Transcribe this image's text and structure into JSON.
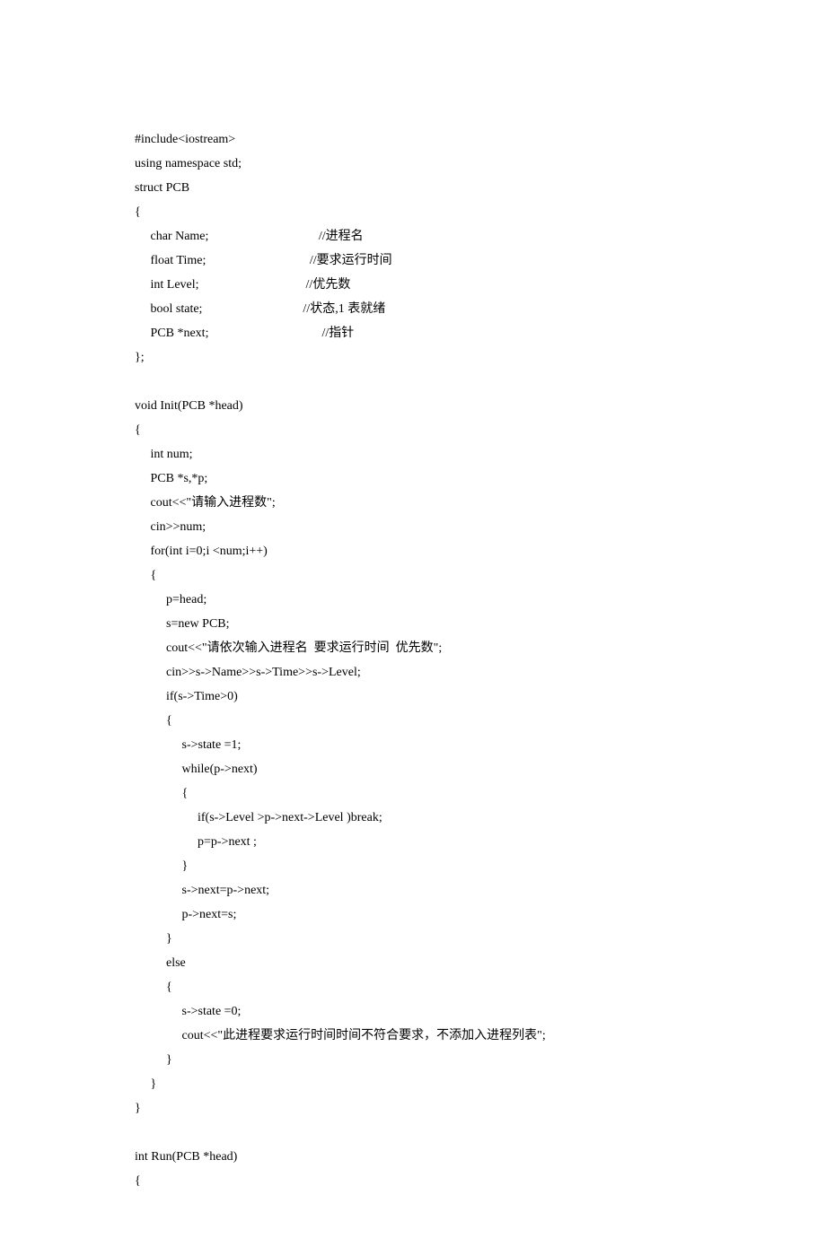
{
  "code": {
    "l1": "#include<iostream>",
    "l2": "using namespace std;",
    "l3": "struct PCB",
    "l4": "{",
    "l5": "     char Name;                                   //进程名",
    "l6": "     float Time;                                 //要求运行时间",
    "l7": "     int Level;                                  //优先数",
    "l8": "     bool state;                                //状态,1 表就绪",
    "l9": "     PCB *next;                                    //指针",
    "l10": "};",
    "l11": "",
    "l12": "void Init(PCB *head)",
    "l13": "{",
    "l14": "     int num;",
    "l15": "     PCB *s,*p;",
    "l16": "     cout<<\"请输入进程数\";",
    "l17": "     cin>>num;",
    "l18": "     for(int i=0;i <num;i++)",
    "l19": "     {",
    "l20": "          p=head;",
    "l21": "          s=new PCB;",
    "l22": "          cout<<\"请依次输入进程名  要求运行时间  优先数\";",
    "l23": "          cin>>s->Name>>s->Time>>s->Level;",
    "l24": "          if(s->Time>0)",
    "l25": "          {",
    "l26": "               s->state =1;",
    "l27": "               while(p->next)",
    "l28": "               {",
    "l29": "                    if(s->Level >p->next->Level )break;",
    "l30": "                    p=p->next ;",
    "l31": "               }",
    "l32": "               s->next=p->next;",
    "l33": "               p->next=s;",
    "l34": "          }",
    "l35": "          else",
    "l36": "          {",
    "l37": "               s->state =0;",
    "l38": "               cout<<\"此进程要求运行时间时间不符合要求，不添加入进程列表\";",
    "l39": "          }",
    "l40": "     }",
    "l41": "}",
    "l42": "",
    "l43": "int Run(PCB *head)",
    "l44": "{"
  }
}
